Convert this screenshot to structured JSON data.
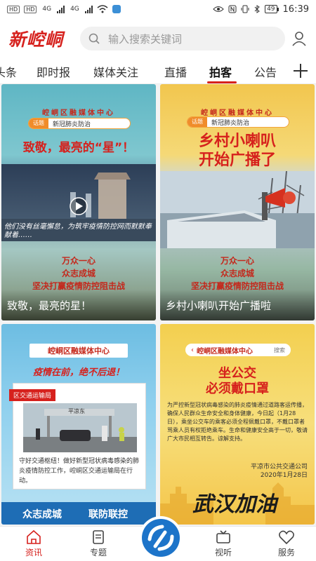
{
  "status_bar": {
    "sim1": "HD",
    "sim2": "HD",
    "net1": "4G",
    "net2": "4G",
    "battery": "49",
    "time": "16:39"
  },
  "header": {
    "logo": "新崆峒",
    "search_placeholder": "输入搜索关键词"
  },
  "tabs": [
    {
      "label": "头条"
    },
    {
      "label": "即时报"
    },
    {
      "label": "媒体关注"
    },
    {
      "label": "直播"
    },
    {
      "label": "拍客",
      "active": true
    },
    {
      "label": "公告"
    }
  ],
  "cards": [
    {
      "org": "崆峒区融媒体中心",
      "tag": "话题",
      "topic": "新冠肺炎防治",
      "headline": "致敬，最亮的“星”！",
      "photo_text": "他们没有丝毫懈怠，为筑牢疫情防控网而默默奉献着……",
      "slogan_lines": [
        "万众一心",
        "众志成城",
        "坚决打赢疫情防控阻击战"
      ],
      "caption": "致敬，最亮的星！"
    },
    {
      "org": "崆峒区融媒体中心",
      "tag": "话题",
      "topic": "新冠肺炎防治",
      "headline_lines": [
        "乡村小喇叭",
        "开始广播了"
      ],
      "slogan_lines": [
        "万众一心",
        "众志成城",
        "坚决打赢疫情防控阻击战"
      ],
      "caption": "乡村小喇叭开始广播啦"
    },
    {
      "org": "崆峒区融媒体中心",
      "headline": "疫情在前，绝不后退！",
      "sub_label": "区交通运输局",
      "sign_text": "平凉东",
      "body": "守好交通枢纽！做好新型冠状病毒感染的肺炎疫情防控工作，崆峒区交通运输局在行动。",
      "footer_left": "众志成城",
      "footer_right": "联防联控"
    },
    {
      "org": "崆峒区融媒体中心",
      "search_label": "搜索",
      "headline_lines": [
        "坐公交",
        "必须戴口罩"
      ],
      "body": "为严控新型冠状病毒感染的肺炎疫情通过道路客运传播，确保人民群众生命安全和身体健康，今日起（1月28日），乘坐公交车的乘客必须全程佩戴口罩，不戴口罩者骂乘人员有权拒绝乘车。生命和健康安全高于一切，敬请广大市民相互转告。谅解支持。",
      "issuer": "平凉市公共交通公司",
      "date": "2020年1月28日",
      "calligraphy": "武汉加油"
    }
  ],
  "bottom_nav": [
    {
      "label": "资讯",
      "active": true
    },
    {
      "label": "专题"
    },
    {
      "label": ""
    },
    {
      "label": "视听"
    },
    {
      "label": "服务"
    }
  ],
  "colors": {
    "brand": "#d6211d",
    "accent_orange": "#f08c2a"
  }
}
